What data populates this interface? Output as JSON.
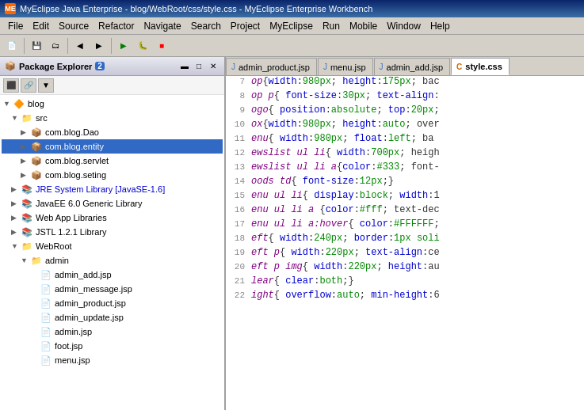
{
  "titleBar": {
    "title": "MyEclipse Java Enterprise - blog/WebRoot/css/style.css - MyEclipse Enterprise Workbench",
    "icon": "ME"
  },
  "menuBar": {
    "items": [
      "File",
      "Edit",
      "Source",
      "Refactor",
      "Navigate",
      "Search",
      "Project",
      "MyEclipse",
      "Run",
      "Mobile",
      "Window",
      "Help"
    ]
  },
  "packageExplorer": {
    "title": "Package Explorer",
    "badge": "2",
    "tree": [
      {
        "id": "blog",
        "label": "blog",
        "indent": 0,
        "type": "project",
        "expanded": true
      },
      {
        "id": "src",
        "label": "src",
        "indent": 1,
        "type": "src",
        "expanded": true
      },
      {
        "id": "com.blog.Dao",
        "label": "com.blog.Dao",
        "indent": 2,
        "type": "package"
      },
      {
        "id": "com.blog.entity",
        "label": "com.blog.entity",
        "indent": 2,
        "type": "package",
        "selected": true
      },
      {
        "id": "com.blog.servlet",
        "label": "com.blog.servlet",
        "indent": 2,
        "type": "package"
      },
      {
        "id": "com.blog.seting",
        "label": "com.blog.seting",
        "indent": 2,
        "type": "package"
      },
      {
        "id": "jre",
        "label": "JRE System Library [JavaSE-1.6]",
        "indent": 1,
        "type": "library"
      },
      {
        "id": "javaee",
        "label": "JavaEE 6.0 Generic Library",
        "indent": 1,
        "type": "library"
      },
      {
        "id": "webapp",
        "label": "Web App Libraries",
        "indent": 1,
        "type": "library"
      },
      {
        "id": "jstl",
        "label": "JSTL 1.2.1 Library",
        "indent": 1,
        "type": "library"
      },
      {
        "id": "webroot",
        "label": "WebRoot",
        "indent": 1,
        "type": "folder",
        "expanded": true
      },
      {
        "id": "admin",
        "label": "admin",
        "indent": 2,
        "type": "folder",
        "expanded": true
      },
      {
        "id": "admin_add",
        "label": "admin_add.jsp",
        "indent": 3,
        "type": "jsp"
      },
      {
        "id": "admin_message",
        "label": "admin_message.jsp",
        "indent": 3,
        "type": "jsp"
      },
      {
        "id": "admin_product",
        "label": "admin_product.jsp",
        "indent": 3,
        "type": "jsp"
      },
      {
        "id": "admin_update",
        "label": "admin_update.jsp",
        "indent": 3,
        "type": "jsp"
      },
      {
        "id": "admin_file",
        "label": "admin.jsp",
        "indent": 3,
        "type": "jsp"
      },
      {
        "id": "foot",
        "label": "foot.jsp",
        "indent": 3,
        "type": "jsp"
      },
      {
        "id": "menu_file",
        "label": "menu.jsp",
        "indent": 3,
        "type": "jsp"
      }
    ]
  },
  "editor": {
    "tabs": [
      {
        "id": "admin_product",
        "label": "admin_product.jsp",
        "icon": "J",
        "active": false
      },
      {
        "id": "menu",
        "label": "menu.jsp",
        "icon": "J",
        "active": false
      },
      {
        "id": "admin_add",
        "label": "admin_add.jsp",
        "icon": "J",
        "active": false
      },
      {
        "id": "style",
        "label": "style.css",
        "icon": "C",
        "active": true
      }
    ],
    "codeLines": [
      {
        "num": "7",
        "text": "op{width:980px; height:175px; bac"
      },
      {
        "num": "8",
        "text": "op p{ font-size:30px; text-align:"
      },
      {
        "num": "9",
        "text": "ogo{ position:absolute; top:20px;"
      },
      {
        "num": "10",
        "text": "ox{width:980px; height:auto; over"
      },
      {
        "num": "11",
        "text": "enu{ width:980px; float:left;  ba"
      },
      {
        "num": "12",
        "text": "ewslist ul li{ width:700px; heigh"
      },
      {
        "num": "13",
        "text": "ewslist ul li a{color:#333; font-"
      },
      {
        "num": "14",
        "text": "oods td{ font-size:12px;}"
      },
      {
        "num": "15",
        "text": "enu ul li{ display:block; width:1"
      },
      {
        "num": "16",
        "text": "enu ul li a {color:#fff; text-dec"
      },
      {
        "num": "17",
        "text": "enu ul li a:hover{ color:#FFFFFF;"
      },
      {
        "num": "18",
        "text": "eft{ width:240px; border:1px soli"
      },
      {
        "num": "19",
        "text": "eft p{ width:220px; text-align:ce"
      },
      {
        "num": "20",
        "text": "eft p img{ width:220px; height:au"
      },
      {
        "num": "21",
        "text": "lear{ clear:both;}"
      },
      {
        "num": "22",
        "text": "ight{ overflow:auto; min-height:6"
      }
    ]
  }
}
